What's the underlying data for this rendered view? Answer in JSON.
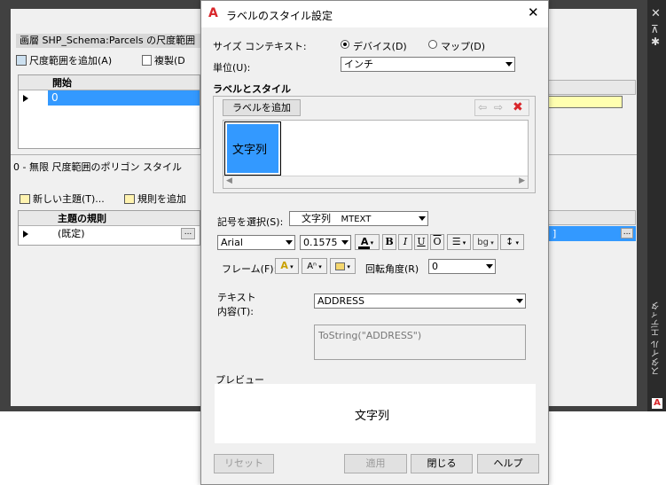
{
  "background_app": {
    "panel1_title": "画層 SHP_Schema:Parcels の尺度範囲",
    "add_scale_range": "尺度範囲を追加(A)",
    "duplicate": "複製(D",
    "grid1_header": "開始",
    "grid1_row": "0",
    "panel2_title": "0 - 無限 尺度範囲のポリゴン スタイル",
    "new_theme": "新しい主題(T)...",
    "add_rule": "規則を追加",
    "grid2_header": "主題の規則",
    "grid2_row": "(既定)",
    "ellipsis": "...",
    "right_panel_label": "スタイル エディタ"
  },
  "dialog": {
    "title": "ラベルのスタイル設定",
    "size_context_label": "サイズ コンテキスト:",
    "radio_device": "デバイス(D)",
    "radio_map": "マップ(D)",
    "unit_label": "単位(U):",
    "unit_value": "インチ",
    "labels_styles_heading": "ラベルとスタイル",
    "add_label_button": "ラベルを追加",
    "label_tile_text": "文字列",
    "symbol_select_label": "記号を選択(S):",
    "symbol_value": "文字列",
    "symbol_type": "MTEXT",
    "font_value": "Arial",
    "size_value": "0.1575",
    "bold": "B",
    "italic": "I",
    "underline": "U",
    "overline": "O",
    "frame_label": "フレーム(F):",
    "rotation_label": "回転角度(R)",
    "rotation_value": "0",
    "text_content_label_1": "テキスト",
    "text_content_label_2": "内容(T):",
    "content_value": "ADDRESS",
    "expression": "ToString(\"ADDRESS\")",
    "preview_label": "プレビュー",
    "preview_text": "文字列",
    "reset_button": "リセット",
    "apply_button": "適用",
    "close_button": "閉じる",
    "help_button": "ヘルプ"
  },
  "colors": {
    "selection": "#3399ff",
    "autocad_red": "#d9262b",
    "background_dark": "#414141"
  }
}
